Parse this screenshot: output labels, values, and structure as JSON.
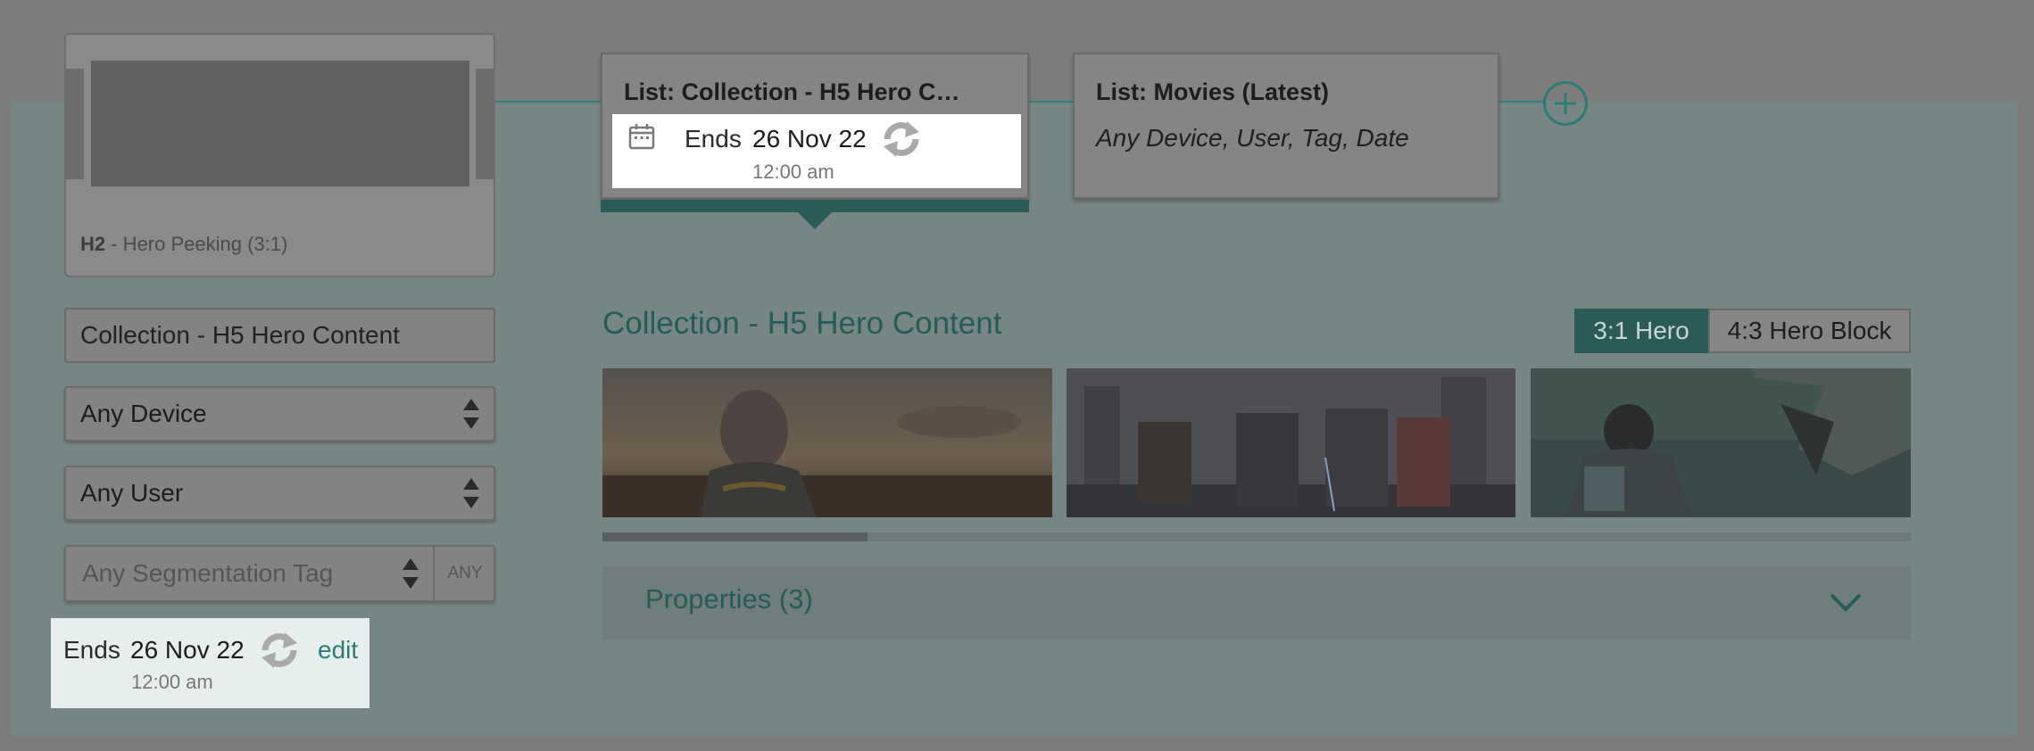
{
  "preview": {
    "code": "H2",
    "caption": " - Hero Peeking (3:1)"
  },
  "form": {
    "collection_value": "Collection - H5 Hero Content",
    "device_select": "Any Device",
    "user_select": "Any User",
    "segmentation_placeholder": "Any Segmentation Tag",
    "segmentation_any": "ANY"
  },
  "schedule_left": {
    "ends_label": "Ends",
    "date": "26 Nov 22",
    "time": "12:00 am",
    "edit_label": "edit"
  },
  "lists": [
    {
      "title": "List: Collection - H5 Hero C…",
      "ends_label": "Ends",
      "date": "26 Nov 22",
      "time": "12:00 am"
    },
    {
      "title": "List: Movies (Latest)",
      "subtitle": "Any Device, User, Tag, Date"
    }
  ],
  "content": {
    "title": "Collection - H5 Hero Content",
    "toggle_active": "3:1 Hero",
    "toggle_inactive": "4:3 Hero Block",
    "properties_label": "Properties (3)",
    "scroll_position_fraction": 0.2
  },
  "colors": {
    "accent_teal": "#2a7d75",
    "dark_teal": "#2b5b57",
    "dim_overlay": "#7c7c7c"
  },
  "icons": [
    "calendar-icon",
    "refresh-icon",
    "plus-icon",
    "chevron-down-icon",
    "select-arrows-icon"
  ]
}
